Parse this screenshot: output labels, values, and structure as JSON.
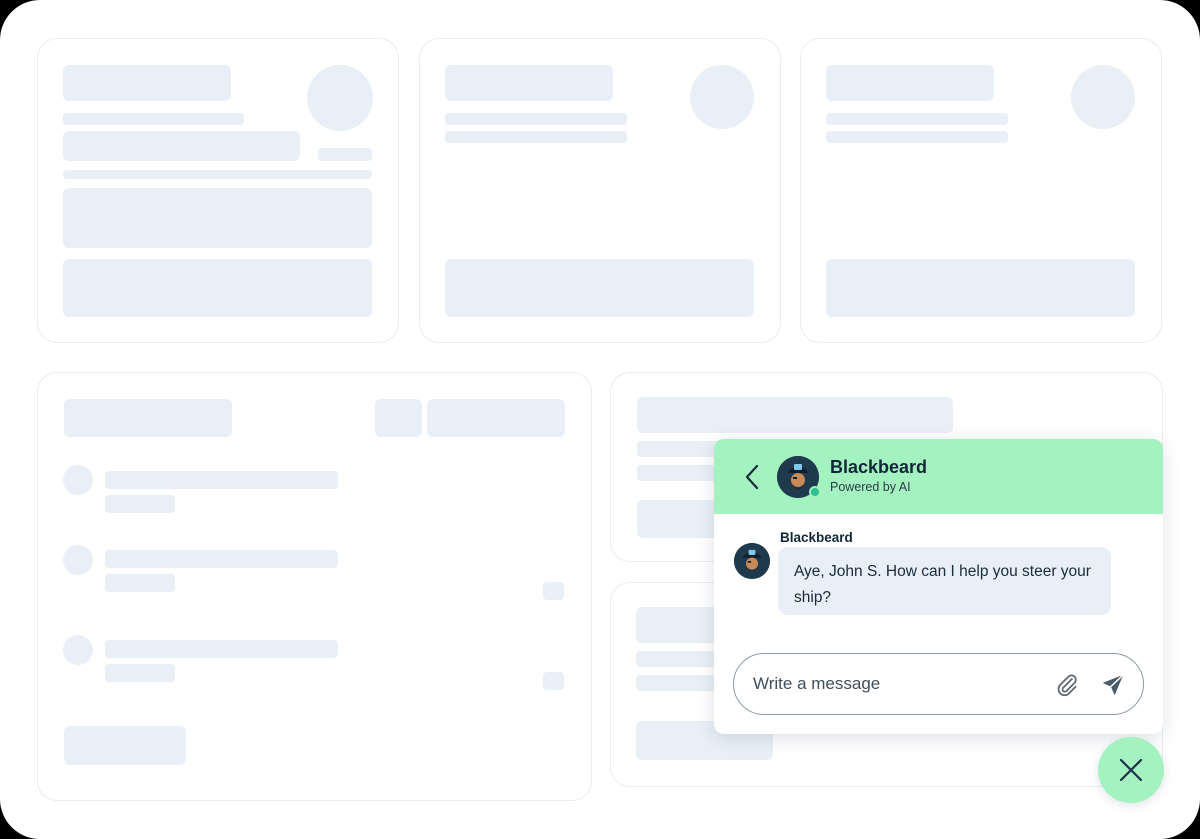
{
  "chat": {
    "header": {
      "name": "Blackbeard",
      "subtitle": "Powered by AI",
      "back_icon": "chevron-left-icon",
      "avatar": "pirate-avatar",
      "status": "online"
    },
    "messages": [
      {
        "sender": "Blackbeard",
        "text": "Aye, John S. How can I help you steer your ship?"
      }
    ],
    "composer": {
      "value": "",
      "placeholder": "Write a message",
      "attach_icon": "paperclip-icon",
      "send_icon": "send-icon"
    },
    "close_icon": "close-icon"
  },
  "colors": {
    "accent": "#a4f2c0",
    "skeleton": "#e8eff6",
    "bubble": "#e8eff6",
    "online": "#2fbf92",
    "text_dark": "#12263a"
  }
}
